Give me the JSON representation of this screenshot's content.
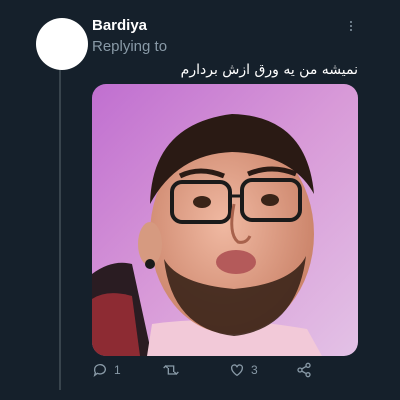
{
  "tweet": {
    "author_name": "Bardiya",
    "replying_to": "Replying to",
    "text": "نمیشه من یه ورق ازش بردارم",
    "media": {
      "description": "photo"
    }
  },
  "actions": {
    "reply_count": "1",
    "retweet_count": "",
    "like_count": "3",
    "share_count": ""
  },
  "icons": {
    "more": "more-vertical-icon",
    "reply": "reply-icon",
    "retweet": "retweet-icon",
    "like": "heart-icon",
    "share": "share-icon"
  },
  "colors": {
    "background": "#15202b",
    "text_primary": "#ffffff",
    "text_secondary": "#8899a6",
    "thread_line": "#38444d"
  }
}
